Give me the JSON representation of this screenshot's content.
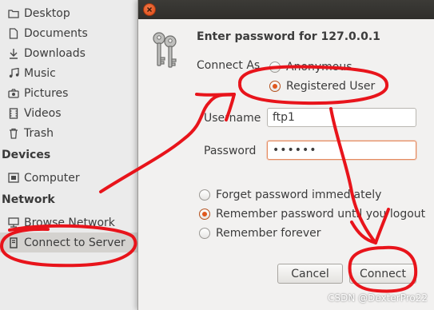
{
  "sidebar": {
    "places": [
      {
        "label": "Desktop",
        "icon": "folder-icon"
      },
      {
        "label": "Documents",
        "icon": "document-icon"
      },
      {
        "label": "Downloads",
        "icon": "download-icon"
      },
      {
        "label": "Music",
        "icon": "music-icon"
      },
      {
        "label": "Pictures",
        "icon": "camera-icon"
      },
      {
        "label": "Videos",
        "icon": "film-icon"
      },
      {
        "label": "Trash",
        "icon": "trash-icon"
      }
    ],
    "devices_header": "Devices",
    "devices": [
      {
        "label": "Computer",
        "icon": "computer-icon"
      }
    ],
    "network_header": "Network",
    "network": [
      {
        "label": "Browse Network",
        "icon": "network-icon"
      },
      {
        "label": "Connect to Server",
        "icon": "server-icon",
        "selected": true
      }
    ]
  },
  "dialog": {
    "title": "Enter password for 127.0.0.1",
    "connect_as_label": "Connect As",
    "connect_as_options": [
      {
        "label": "Anonymous",
        "checked": false
      },
      {
        "label": "Registered User",
        "checked": true
      }
    ],
    "username_label": "Username",
    "username_value": "ftp1",
    "password_label": "Password",
    "password_value": "••••••",
    "remember_options": [
      {
        "label": "Forget password immediately",
        "checked": false
      },
      {
        "label": "Remember password until you logout",
        "checked": true
      },
      {
        "label": "Remember forever",
        "checked": false
      }
    ],
    "cancel_label": "Cancel",
    "connect_label": "Connect"
  },
  "colors": {
    "accent": "#e0581d",
    "annotation": "#e8141b"
  },
  "watermark": "CSDN @DexterPro22"
}
